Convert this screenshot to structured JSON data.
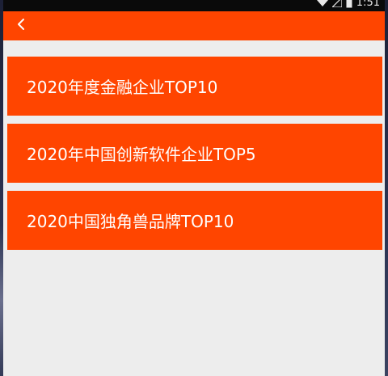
{
  "status_bar": {
    "time": "1:51",
    "icons": [
      "wifi-icon",
      "signal-icon",
      "battery-icon"
    ]
  },
  "app_bar": {
    "back_icon": "chevron-left-icon",
    "color": "#ff4500"
  },
  "list": {
    "items": [
      {
        "label": "2020年度金融企业TOP10"
      },
      {
        "label": "2020年中国创新软件企业TOP5"
      },
      {
        "label": "2020中国独角兽品牌TOP10"
      }
    ]
  },
  "colors": {
    "accent": "#ff4500",
    "background": "#ededed",
    "status_bar": "#0a0a0a"
  }
}
